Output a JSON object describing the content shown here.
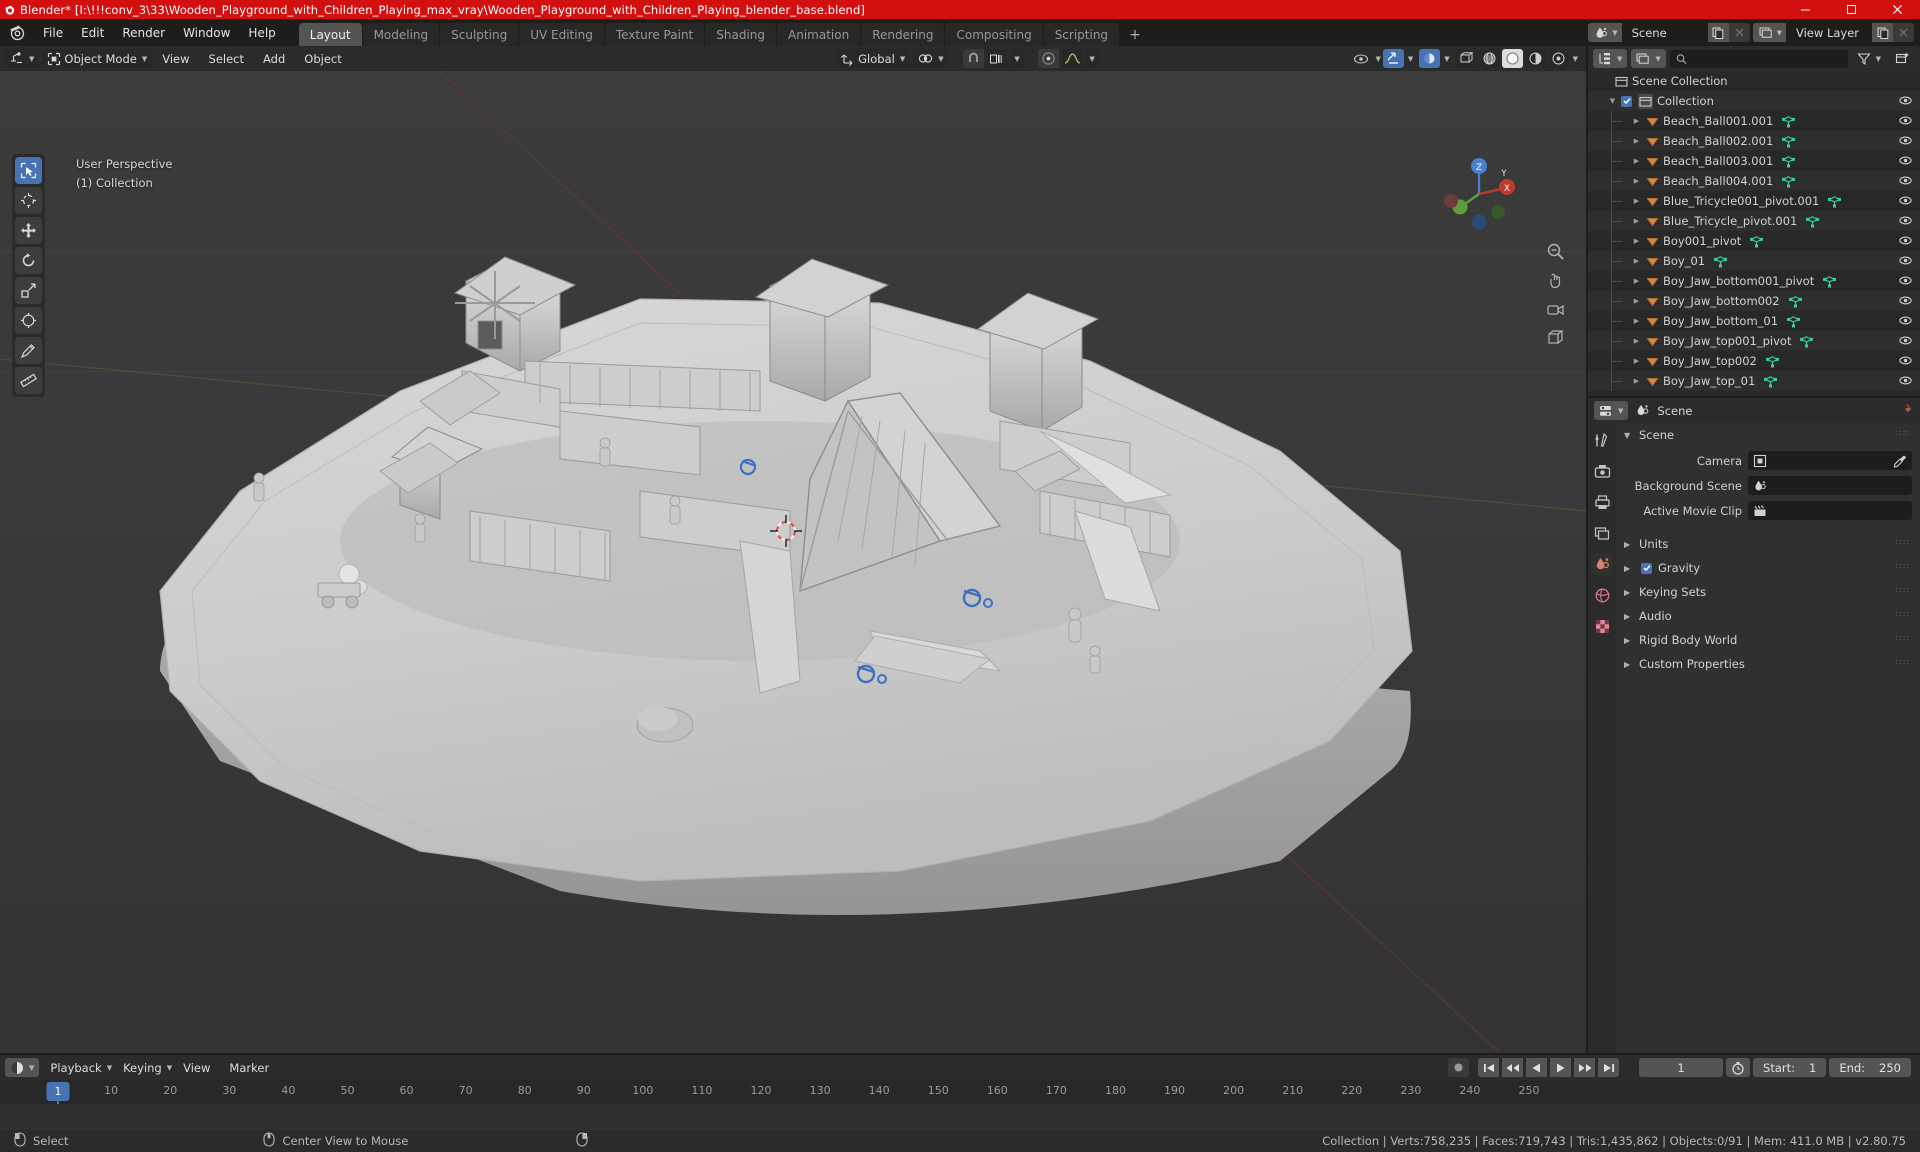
{
  "window": {
    "title": "Blender* [I:\\!!!conv_3\\33\\Wooden_Playground_with_Children_Playing_max_vray\\Wooden_Playground_with_Children_Playing_blender_base.blend]",
    "titlebar_color": "#d31010",
    "minimize_label": "─",
    "maximize_label": "☐",
    "close_label": "✕"
  },
  "topbar": {
    "menus": [
      "File",
      "Edit",
      "Render",
      "Window",
      "Help"
    ],
    "workspaces": [
      {
        "label": "Layout",
        "active": true
      },
      {
        "label": "Modeling",
        "active": false
      },
      {
        "label": "Sculpting",
        "active": false
      },
      {
        "label": "UV Editing",
        "active": false
      },
      {
        "label": "Texture Paint",
        "active": false
      },
      {
        "label": "Shading",
        "active": false
      },
      {
        "label": "Animation",
        "active": false
      },
      {
        "label": "Rendering",
        "active": false
      },
      {
        "label": "Compositing",
        "active": false
      },
      {
        "label": "Scripting",
        "active": false
      }
    ],
    "add_workspace_label": "+",
    "scene_name": "Scene",
    "view_layer_name": "View Layer"
  },
  "viewport": {
    "header": {
      "editor_type_icon": "editor-type-icon",
      "mode": "Object Mode",
      "menus": [
        "View",
        "Select",
        "Add",
        "Object"
      ],
      "transform_orientation": "Global",
      "pivot_icon": "pivot-point-icon",
      "snap_icon": "snap-magnet-icon",
      "snap_target_icon": "snap-increment-icon",
      "proportional_icon": "proportional-editing-icon",
      "falloff_icon": "falloff-curve-icon"
    },
    "overlay": {
      "perspective": "User Perspective",
      "collection": "(1) Collection"
    },
    "gizmo_axes": [
      "X",
      "Y",
      "Z"
    ],
    "tools": [
      "select-box-tool",
      "cursor-tool",
      "move-tool",
      "rotate-tool",
      "scale-tool",
      "transform-tool",
      "annotate-tool",
      "measure-tool"
    ],
    "nav_icons": [
      "zoom-icon",
      "move-view-icon",
      "camera-view-icon",
      "toggle-perspective-icon"
    ],
    "shading_icons": [
      "wireframe-shading-icon",
      "solid-shading-icon",
      "material-shading-icon",
      "rendered-shading-icon"
    ],
    "visibility_icons": [
      "show-gizmo-icon",
      "show-overlays-icon",
      "xray-toggle-icon"
    ]
  },
  "outliner": {
    "display_mode_icon": "outliner-display-mode-icon",
    "filter_id_icon": "view-layer-icon",
    "search_placeholder": "",
    "filter_icon": "filter-icon",
    "new_collection_icon": "new-collection-icon",
    "scene_collection": "Scene Collection",
    "collection": "Collection",
    "items": [
      "Beach_Ball001.001",
      "Beach_Ball002.001",
      "Beach_Ball003.001",
      "Beach_Ball004.001",
      "Blue_Tricycle001_pivot.001",
      "Blue_Tricycle_pivot.001",
      "Boy001_pivot",
      "Boy_01",
      "Boy_Jaw_bottom001_pivot",
      "Boy_Jaw_bottom002",
      "Boy_Jaw_bottom_01",
      "Boy_Jaw_top001_pivot",
      "Boy_Jaw_top002",
      "Boy_Jaw_top_01"
    ]
  },
  "properties": {
    "breadcrumb_icon": "scene-properties-icon",
    "breadcrumb": "Scene",
    "pin_icon": "pin-icon",
    "tabs": [
      "tool-properties-tab",
      "render-properties-tab",
      "output-properties-tab",
      "view-layer-properties-tab",
      "scene-properties-tab",
      "world-properties-tab",
      "texture-properties-tab"
    ],
    "section_title": "Scene",
    "fields": [
      {
        "label": "Camera",
        "value": "",
        "icon": "camera-icon",
        "has_picker": true
      },
      {
        "label": "Background Scene",
        "value": "",
        "icon": "scene-icon",
        "has_picker": false
      },
      {
        "label": "Active Movie Clip",
        "value": "",
        "icon": "movie-clip-icon",
        "has_picker": false
      }
    ],
    "panels": [
      {
        "label": "Units",
        "checkbox": null
      },
      {
        "label": "Gravity",
        "checkbox": true
      },
      {
        "label": "Keying Sets",
        "checkbox": null
      },
      {
        "label": "Audio",
        "checkbox": null
      },
      {
        "label": "Rigid Body World",
        "checkbox": null
      },
      {
        "label": "Custom Properties",
        "checkbox": null
      }
    ]
  },
  "timeline": {
    "editor_icon": "timeline-editor-icon",
    "menus": [
      "Playback",
      "Keying",
      "View",
      "Marker"
    ],
    "record_icon": "auto-keying-icon",
    "transport_icons": [
      "jump-start-icon",
      "prev-keyframe-icon",
      "play-reverse-icon",
      "play-icon",
      "next-keyframe-icon",
      "jump-end-icon"
    ],
    "current_frame": "1",
    "use_preview_icon": "stopwatch-icon",
    "start_label": "Start:",
    "start_value": "1",
    "end_label": "End:",
    "end_value": "250",
    "ticks": [
      "10",
      "20",
      "30",
      "40",
      "50",
      "60",
      "70",
      "80",
      "90",
      "100",
      "110",
      "120",
      "130",
      "140",
      "150",
      "160",
      "170",
      "180",
      "190",
      "200",
      "210",
      "220",
      "230",
      "240",
      "250"
    ],
    "playhead_label": "1"
  },
  "statusbar": {
    "mouse_left_icon": "mouse-left-icon",
    "left_action": "Select",
    "mouse_middle_icon": "mouse-middle-icon",
    "middle_action": "Center View to Mouse",
    "mouse_right_icon": "mouse-right-icon",
    "stats": "Collection | Verts:758,235 | Faces:719,743 | Tris:1,435,862 | Objects:0/91 | Mem: 411.0 MB | v2.80.75"
  }
}
